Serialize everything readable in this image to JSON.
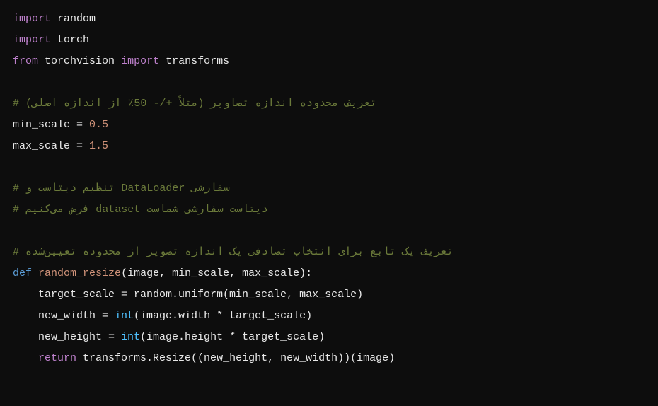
{
  "lines": {
    "l1_import": "import",
    "l1_mod": "random",
    "l2_import": "import",
    "l2_mod": "torch",
    "l3_from": "from",
    "l3_mod": "torchvision",
    "l3_import": "import",
    "l3_name": "transforms",
    "l5_comment": "# تعریف محدوده اندازه تصاویر (مثلاً +/- 50٪ از اندازه اصلی)",
    "l6_var": "min_scale",
    "l6_eq": " = ",
    "l6_val": "0.5",
    "l7_var": "max_scale",
    "l7_eq": " = ",
    "l7_val": "1.5",
    "l9_comment": "# تنظیم دیتاست و DataLoader سفارشی",
    "l10_comment": "# فرض می‌کنیم dataset دیتاست سفارشی شماست",
    "l12_comment": "# تعریف یک تابع برای انتخاب تصادفی یک اندازه تصویر از محدوده تعیین‌شده",
    "l13_def": "def",
    "l13_name": "random_resize",
    "l13_params": "(image, min_scale, max_scale):",
    "l14": "    target_scale = random.uniform(min_scale, max_scale)",
    "l15_pre": "    new_width = ",
    "l15_int": "int",
    "l15_post": "(image.width * target_scale)",
    "l16_pre": "    new_height = ",
    "l16_int": "int",
    "l16_post": "(image.height * target_scale)",
    "l17_ret": "return",
    "l17_post": " transforms.Resize((new_height, new_width))(image)"
  }
}
